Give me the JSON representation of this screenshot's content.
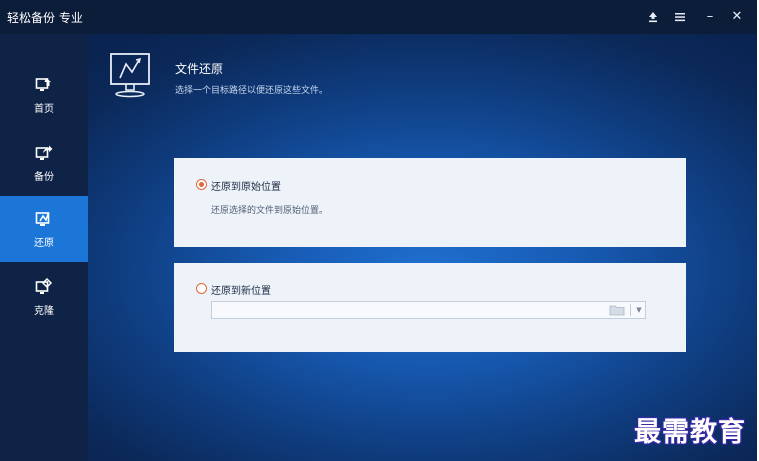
{
  "window": {
    "title": "轻松备份 专业"
  },
  "titlebar": {
    "buttons": [
      {
        "icon": "upgrade-icon"
      },
      {
        "icon": "menu-icon"
      },
      {
        "icon": "minimize-icon",
        "glyph": "–"
      },
      {
        "icon": "close-icon",
        "glyph": "✕"
      }
    ]
  },
  "sidebar": {
    "items": [
      {
        "label": "首页",
        "icon": "home-icon",
        "active": false
      },
      {
        "label": "备份",
        "icon": "backup-icon",
        "active": false
      },
      {
        "label": "还原",
        "icon": "restore-icon",
        "active": true
      },
      {
        "label": "克隆",
        "icon": "clone-icon",
        "active": false
      }
    ]
  },
  "header": {
    "title": "文件还原",
    "subtitle": "选择一个目标路径以便还原这些文件。",
    "icon": "monitor-restore-icon"
  },
  "options": {
    "original": {
      "label": "还原到原始位置",
      "description": "还原选择的文件到原始位置。",
      "selected": true
    },
    "new_location": {
      "label": "还原到新位置",
      "selected": false,
      "path_value": ""
    }
  },
  "watermark": {
    "text": "最需教育"
  },
  "colors": {
    "accent": "#1b76d8",
    "radio": "#e2673c",
    "titlebar": "#0c1d3a",
    "sidebar": "#0f2346"
  }
}
